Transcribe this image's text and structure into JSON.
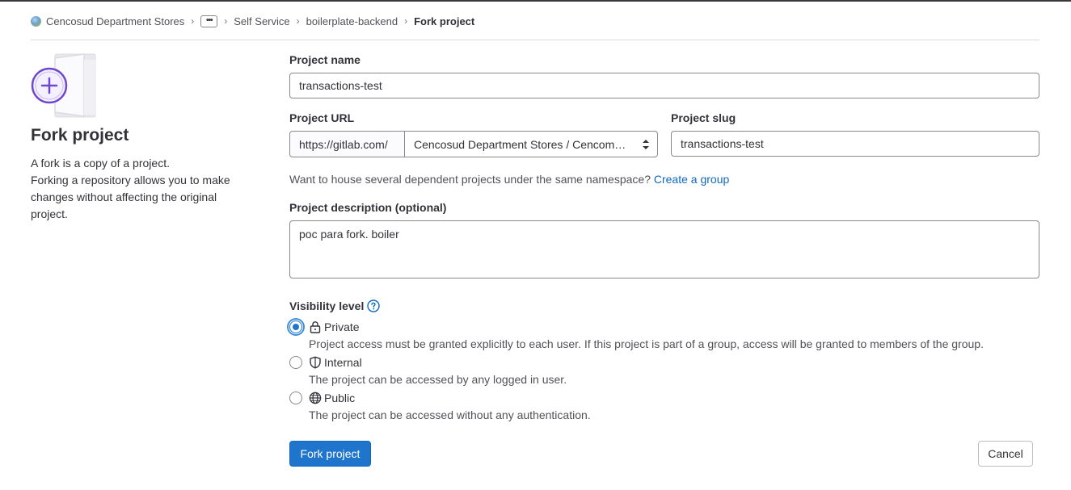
{
  "breadcrumb": {
    "items": [
      "Cencosud Department Stores",
      "Self Service",
      "boilerplate-backend"
    ],
    "ellipsis": "•••",
    "current": "Fork project",
    "separator": "›"
  },
  "sidebar": {
    "title": "Fork project",
    "description_lines": [
      "A fork is a copy of a project.",
      "Forking a repository allows you to make",
      "changes without affecting the original",
      "project."
    ]
  },
  "form": {
    "project_name_label": "Project name",
    "project_name_value": "transactions-test",
    "project_url_label": "Project URL",
    "url_prefix": "https://gitlab.com/",
    "namespace_selected": "Cencosud Department Stores / Cencommerce",
    "project_slug_label": "Project slug",
    "project_slug_value": "transactions-test",
    "namespace_help": "Want to house several dependent projects under the same namespace?",
    "create_group_link": "Create a group",
    "description_label": "Project description (optional)",
    "description_value": "poc para fork. boiler",
    "visibility_label": "Visibility level",
    "visibility_options": [
      {
        "label": "Private",
        "icon": "lock-icon",
        "help": "Project access must be granted explicitly to each user. If this project is part of a group, access will be granted to members of the group.",
        "checked": true
      },
      {
        "label": "Internal",
        "icon": "shield-icon",
        "help": "The project can be accessed by any logged in user.",
        "checked": false
      },
      {
        "label": "Public",
        "icon": "globe-icon",
        "help": "The project can be accessed without any authentication.",
        "checked": false
      }
    ]
  },
  "actions": {
    "submit_label": "Fork project",
    "cancel_label": "Cancel"
  },
  "colors": {
    "primary": "#1f75cb",
    "link": "#1068bf",
    "illustration_purple": "#6e49cb"
  }
}
